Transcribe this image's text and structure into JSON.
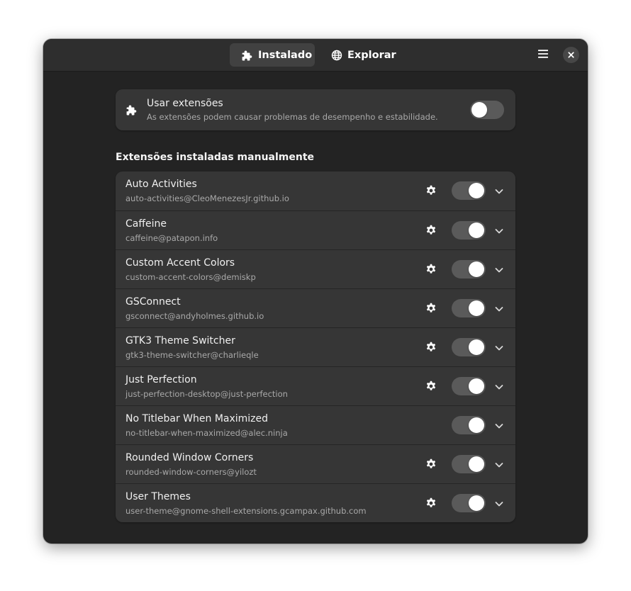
{
  "header": {
    "tabs": [
      {
        "label": "Instalado",
        "icon": "puzzle-icon",
        "active": true
      },
      {
        "label": "Explorar",
        "icon": "globe-icon",
        "active": false
      }
    ],
    "menu_icon": "hamburger-menu-icon",
    "close_icon": "close-icon"
  },
  "global": {
    "title": "Usar extensões",
    "subtitle": "As extensões podem causar problemas de desempenho e estabilidade.",
    "enabled": false
  },
  "section_title": "Extensões instaladas manualmente",
  "extensions": [
    {
      "name": "Auto Activities",
      "uuid": "auto-activities@CleoMenezesJr.github.io",
      "has_settings": true,
      "enabled": true
    },
    {
      "name": "Caffeine",
      "uuid": "caffeine@patapon.info",
      "has_settings": true,
      "enabled": true
    },
    {
      "name": "Custom Accent Colors",
      "uuid": "custom-accent-colors@demiskp",
      "has_settings": true,
      "enabled": true
    },
    {
      "name": "GSConnect",
      "uuid": "gsconnect@andyholmes.github.io",
      "has_settings": true,
      "enabled": true
    },
    {
      "name": "GTK3 Theme Switcher",
      "uuid": "gtk3-theme-switcher@charlieqle",
      "has_settings": true,
      "enabled": true
    },
    {
      "name": "Just Perfection",
      "uuid": "just-perfection-desktop@just-perfection",
      "has_settings": true,
      "enabled": true
    },
    {
      "name": "No Titlebar When Maximized",
      "uuid": "no-titlebar-when-maximized@alec.ninja",
      "has_settings": false,
      "enabled": true
    },
    {
      "name": "Rounded Window Corners",
      "uuid": "rounded-window-corners@yilozt",
      "has_settings": true,
      "enabled": true
    },
    {
      "name": "User Themes",
      "uuid": "user-theme@gnome-shell-extensions.gcampax.github.com",
      "has_settings": true,
      "enabled": true
    }
  ],
  "colors": {
    "window_bg": "#232323",
    "headerbar_bg": "#2e2e2e",
    "card_bg": "#363636",
    "switch_track": "#5a5a5a",
    "text_primary": "#f0f0f0",
    "text_secondary": "#a9a9a9"
  }
}
